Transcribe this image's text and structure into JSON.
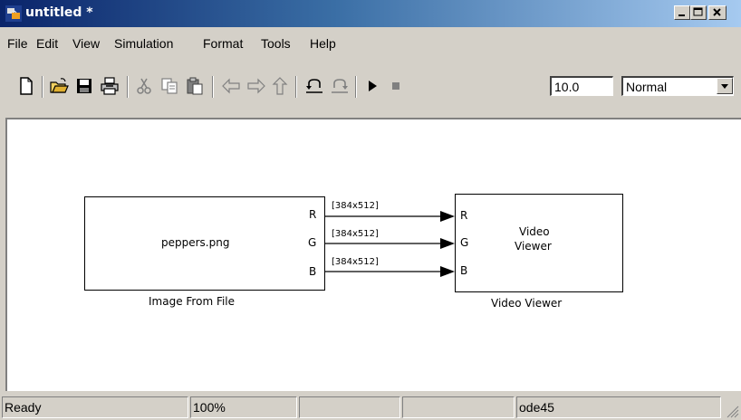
{
  "window": {
    "title": "untitled *",
    "controls": {
      "minimize": "_",
      "maximize": "□",
      "close": "X"
    }
  },
  "menu": [
    "File",
    "Edit",
    "View",
    "Simulation",
    "Format",
    "Tools",
    "Help"
  ],
  "toolbar": {
    "buttons": [
      "new-model-icon",
      "open-icon",
      "save-icon",
      "print-icon",
      "cut-icon",
      "copy-icon",
      "paste-icon",
      "back-icon",
      "forward-icon",
      "up-icon",
      "undo-icon",
      "redo-icon",
      "start-simulation-icon",
      "stop-simulation-icon"
    ],
    "stop_time": "10.0",
    "sim_mode": "Normal"
  },
  "diagram": {
    "source_block": {
      "text": "peppers.png",
      "name": "Image From File",
      "ports": [
        "R",
        "G",
        "B"
      ]
    },
    "sink_block": {
      "text_line1": "Video",
      "text_line2": "Viewer",
      "name": "Video Viewer",
      "ports": [
        "R",
        "G",
        "B"
      ]
    },
    "signals": [
      "[384x512]",
      "[384x512]",
      "[384x512]"
    ]
  },
  "status": {
    "message": "Ready",
    "zoom": "100%",
    "pane3": "",
    "pane4": "",
    "solver": "ode45"
  },
  "colors": {
    "titlebar_start": "#0a246a",
    "titlebar_end": "#a6caf0",
    "window_face": "#d4d0c8"
  }
}
